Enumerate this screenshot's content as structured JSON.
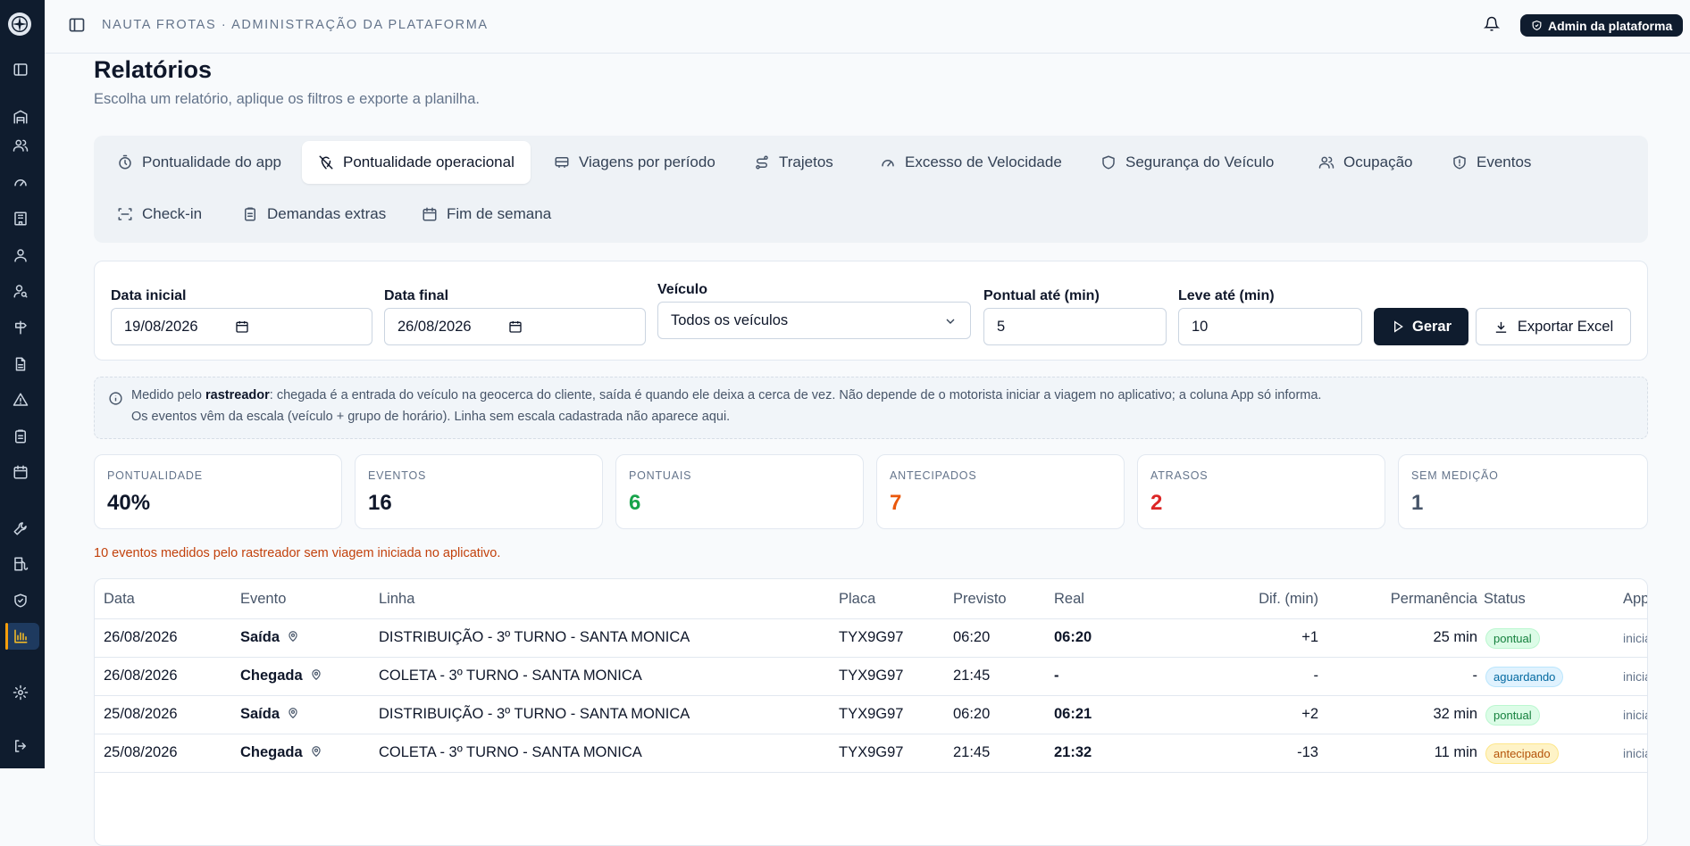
{
  "topbar": {
    "title": "NAUTA FROTAS · ADMINISTRAÇÃO DA PLATAFORMA",
    "admin_badge": "Admin da plataforma"
  },
  "page": {
    "title": "Relatórios",
    "subtitle": "Escolha um relatório, aplique os filtros e exporte a planilha."
  },
  "tabs": [
    {
      "label": "Pontualidade do app",
      "icon": "timer-icon"
    },
    {
      "label": "Pontualidade operacional",
      "icon": "map-pin-off-icon",
      "active": true
    },
    {
      "label": "Viagens por período",
      "icon": "bus-icon"
    },
    {
      "label": "Trajetos",
      "icon": "route-icon"
    },
    {
      "label": "Excesso de Velocidade",
      "icon": "gauge-icon"
    },
    {
      "label": "Segurança do Veículo",
      "icon": "shield-icon"
    },
    {
      "label": "Ocupação",
      "icon": "users-icon"
    },
    {
      "label": "Eventos",
      "icon": "shield-alert-icon"
    },
    {
      "label": "Check-in",
      "icon": "scan-icon"
    },
    {
      "label": "Demandas extras",
      "icon": "clipboard-icon"
    },
    {
      "label": "Fim de semana",
      "icon": "calendar-icon"
    }
  ],
  "filters": {
    "data_inicial": {
      "label": "Data inicial",
      "value": "19/08/2026"
    },
    "data_final": {
      "label": "Data final",
      "value": "26/08/2026"
    },
    "veiculo": {
      "label": "Veículo",
      "value": "Todos os veículos"
    },
    "pontual": {
      "label": "Pontual até (min)",
      "value": "5"
    },
    "leve": {
      "label": "Leve até (min)",
      "value": "10"
    },
    "gerar": "Gerar",
    "exportar": "Exportar Excel"
  },
  "info": {
    "line1_pre": "Medido pelo ",
    "line1_bold": "rastreador",
    "line1_post": ": chegada é a entrada do veículo na geocerca do cliente, saída é quando ele deixa a cerca de vez. Não depende de o motorista iniciar a viagem no aplicativo; a coluna App só informa.",
    "line2": "Os eventos vêm da escala (veículo + grupo de horário). Linha sem escala cadastrada não aparece aqui."
  },
  "stats": [
    {
      "label": "PONTUALIDADE",
      "value": "40%",
      "color": "#0f172a"
    },
    {
      "label": "EVENTOS",
      "value": "16",
      "color": "#0f172a"
    },
    {
      "label": "PONTUAIS",
      "value": "6",
      "color": "#16a34a"
    },
    {
      "label": "ANTECIPADOS",
      "value": "7",
      "color": "#ea580c"
    },
    {
      "label": "ATRASOS",
      "value": "2",
      "color": "#dc2626"
    },
    {
      "label": "SEM MEDIÇÃO",
      "value": "1",
      "color": "#475569"
    }
  ],
  "warning": "10 eventos medidos pelo rastreador sem viagem iniciada no aplicativo.",
  "table": {
    "headers": [
      "Data",
      "Evento",
      "Linha",
      "Placa",
      "Previsto",
      "Real",
      "Dif. (min)",
      "Permanência",
      "Status",
      "App"
    ],
    "rows": [
      {
        "data": "26/08/2026",
        "evento": "Saída",
        "linha": "DISTRIBUIÇÃO - 3º TURNO - SANTA MONICA",
        "placa": "TYX9G97",
        "previsto": "06:20",
        "real": "06:20",
        "dif": "+1",
        "perm": "25 min",
        "status": "pontual",
        "app": "iniciada"
      },
      {
        "data": "26/08/2026",
        "evento": "Chegada",
        "linha": "COLETA - 3º TURNO - SANTA MONICA",
        "placa": "TYX9G97",
        "previsto": "21:45",
        "real": "-",
        "dif": "-",
        "perm": "-",
        "status": "aguardando",
        "app": "iniciada"
      },
      {
        "data": "25/08/2026",
        "evento": "Saída",
        "linha": "DISTRIBUIÇÃO - 3º TURNO - SANTA MONICA",
        "placa": "TYX9G97",
        "previsto": "06:20",
        "real": "06:21",
        "dif": "+2",
        "perm": "32 min",
        "status": "pontual",
        "app": "iniciada"
      },
      {
        "data": "25/08/2026",
        "evento": "Chegada",
        "linha": "COLETA - 3º TURNO - SANTA MONICA",
        "placa": "TYX9G97",
        "previsto": "21:45",
        "real": "21:32",
        "dif": "-13",
        "perm": "11 min",
        "status": "antecipado",
        "app": "iniciada"
      }
    ]
  }
}
